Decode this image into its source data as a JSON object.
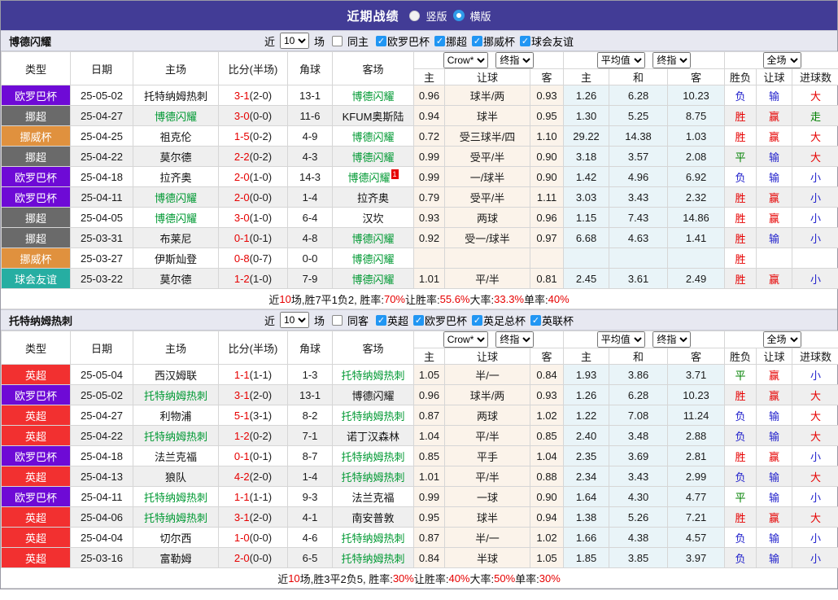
{
  "header": {
    "title": "近期战绩",
    "radio_vertical": "竖版",
    "radio_horizontal": "横版"
  },
  "colors": {
    "topbar_bg": "#423C96",
    "radio_selected_blue": "#2F9BE8",
    "checkbox_checked_blue": "#2196F3",
    "focus_team_green": "#009933",
    "score_red": "#E60000",
    "league_colors": {
      "欧罗巴杯": "#6E0AD6",
      "挪超": "#6A6A6A",
      "挪威杯": "#E0913E",
      "球会友谊": "#26AEA2",
      "英超": "#F23030"
    },
    "result_map": {
      "胜": "#E60000",
      "赢": "#E60000",
      "大": "#E60000",
      "平": "#008000",
      "走": "#008000",
      "负": "#2222CC",
      "输": "#2222CC",
      "小": "#2222CC"
    }
  },
  "table_header": {
    "col_type": "类型",
    "col_date": "日期",
    "col_home": "主场",
    "col_score": "比分(半场)",
    "col_corner": "角球",
    "col_away": "客场",
    "odds_select1": "Crow*",
    "odds_select2": "终指",
    "avg_select1": "平均值",
    "avg_select2": "终指",
    "result_select": "全场",
    "sub_home": "主",
    "sub_handicap": "让球",
    "sub_away": "客",
    "sub_avg_home": "主",
    "sub_avg_draw": "和",
    "sub_avg_away": "客",
    "sub_result": "胜负",
    "sub_result_handicap": "让球",
    "sub_goals": "进球数"
  },
  "sections": [
    {
      "team": "博德闪耀",
      "filter": {
        "near": "近",
        "count": "10",
        "games": "场",
        "same_label": "同主",
        "same_checked": false,
        "leagues": [
          "欧罗巴杯",
          "挪超",
          "挪威杯",
          "球会友谊"
        ]
      },
      "rows": [
        {
          "league": "欧罗巴杯",
          "date": "25-05-02",
          "home": "托特纳姆热刺",
          "home_focus": false,
          "score": "3-1",
          "half": "(2-0)",
          "corner": "13-1",
          "away": "博德闪耀",
          "away_focus": true,
          "away_sup": "",
          "h_odds": "0.96",
          "handicap": "球半/两",
          "a_odds": "0.93",
          "avg_h": "1.26",
          "avg_d": "6.28",
          "avg_a": "10.23",
          "result": "负",
          "h_result": "输",
          "goals": "大"
        },
        {
          "league": "挪超",
          "date": "25-04-27",
          "home": "博德闪耀",
          "home_focus": true,
          "score": "3-0",
          "half": "(0-0)",
          "corner": "11-6",
          "away": "KFUM奥斯陆",
          "away_focus": false,
          "away_sup": "",
          "h_odds": "0.94",
          "handicap": "球半",
          "a_odds": "0.95",
          "avg_h": "1.30",
          "avg_d": "5.25",
          "avg_a": "8.75",
          "result": "胜",
          "h_result": "赢",
          "goals": "走"
        },
        {
          "league": "挪威杯",
          "date": "25-04-25",
          "home": "祖克伦",
          "home_focus": false,
          "score": "1-5",
          "half": "(0-2)",
          "corner": "4-9",
          "away": "博德闪耀",
          "away_focus": true,
          "away_sup": "",
          "h_odds": "0.72",
          "handicap": "受三球半/四",
          "a_odds": "1.10",
          "avg_h": "29.22",
          "avg_d": "14.38",
          "avg_a": "1.03",
          "result": "胜",
          "h_result": "赢",
          "goals": "大"
        },
        {
          "league": "挪超",
          "date": "25-04-22",
          "home": "莫尔德",
          "home_focus": false,
          "score": "2-2",
          "half": "(0-2)",
          "corner": "4-3",
          "away": "博德闪耀",
          "away_focus": true,
          "away_sup": "",
          "h_odds": "0.99",
          "handicap": "受平/半",
          "a_odds": "0.90",
          "avg_h": "3.18",
          "avg_d": "3.57",
          "avg_a": "2.08",
          "result": "平",
          "h_result": "输",
          "goals": "大"
        },
        {
          "league": "欧罗巴杯",
          "date": "25-04-18",
          "home": "拉齐奥",
          "home_focus": false,
          "score": "2-0",
          "half": "(1-0)",
          "corner": "14-3",
          "away": "博德闪耀",
          "away_focus": true,
          "away_sup": "1",
          "h_odds": "0.99",
          "handicap": "一/球半",
          "a_odds": "0.90",
          "avg_h": "1.42",
          "avg_d": "4.96",
          "avg_a": "6.92",
          "result": "负",
          "h_result": "输",
          "goals": "小"
        },
        {
          "league": "欧罗巴杯",
          "date": "25-04-11",
          "home": "博德闪耀",
          "home_focus": true,
          "score": "2-0",
          "half": "(0-0)",
          "corner": "1-4",
          "away": "拉齐奥",
          "away_focus": false,
          "away_sup": "",
          "h_odds": "0.79",
          "handicap": "受平/半",
          "a_odds": "1.11",
          "avg_h": "3.03",
          "avg_d": "3.43",
          "avg_a": "2.32",
          "result": "胜",
          "h_result": "赢",
          "goals": "小"
        },
        {
          "league": "挪超",
          "date": "25-04-05",
          "home": "博德闪耀",
          "home_focus": true,
          "score": "3-0",
          "half": "(1-0)",
          "corner": "6-4",
          "away": "汉坎",
          "away_focus": false,
          "away_sup": "",
          "h_odds": "0.93",
          "handicap": "两球",
          "a_odds": "0.96",
          "avg_h": "1.15",
          "avg_d": "7.43",
          "avg_a": "14.86",
          "result": "胜",
          "h_result": "赢",
          "goals": "小"
        },
        {
          "league": "挪超",
          "date": "25-03-31",
          "home": "布莱尼",
          "home_focus": false,
          "score": "0-1",
          "half": "(0-1)",
          "corner": "4-8",
          "away": "博德闪耀",
          "away_focus": true,
          "away_sup": "",
          "h_odds": "0.92",
          "handicap": "受一/球半",
          "a_odds": "0.97",
          "avg_h": "6.68",
          "avg_d": "4.63",
          "avg_a": "1.41",
          "result": "胜",
          "h_result": "输",
          "goals": "小"
        },
        {
          "league": "挪威杯",
          "date": "25-03-27",
          "home": "伊斯灿登",
          "home_focus": false,
          "score": "0-8",
          "half": "(0-7)",
          "corner": "0-0",
          "away": "博德闪耀",
          "away_focus": true,
          "away_sup": "",
          "h_odds": "",
          "handicap": "",
          "a_odds": "",
          "avg_h": "",
          "avg_d": "",
          "avg_a": "",
          "result": "胜",
          "h_result": "",
          "goals": ""
        },
        {
          "league": "球会友谊",
          "date": "25-03-22",
          "home": "莫尔德",
          "home_focus": false,
          "score": "1-2",
          "half": "(1-0)",
          "corner": "7-9",
          "away": "博德闪耀",
          "away_focus": true,
          "away_sup": "",
          "h_odds": "1.01",
          "handicap": "平/半",
          "a_odds": "0.81",
          "avg_h": "2.45",
          "avg_d": "3.61",
          "avg_a": "2.49",
          "result": "胜",
          "h_result": "赢",
          "goals": "小"
        }
      ],
      "summary": [
        [
          "近",
          0
        ],
        [
          "10",
          1
        ],
        [
          "场,胜7平1负2, 胜率:",
          0
        ],
        [
          "70%",
          1
        ],
        [
          " 让胜率:",
          0
        ],
        [
          "55.6%",
          1
        ],
        [
          " 大率:",
          0
        ],
        [
          "33.3%",
          1
        ],
        [
          " 单率:",
          0
        ],
        [
          "40%",
          1
        ]
      ]
    },
    {
      "team": "托特纳姆热刺",
      "filter": {
        "near": "近",
        "count": "10",
        "games": "场",
        "same_label": "同客",
        "same_checked": false,
        "leagues": [
          "英超",
          "欧罗巴杯",
          "英足总杯",
          "英联杯"
        ]
      },
      "rows": [
        {
          "league": "英超",
          "date": "25-05-04",
          "home": "西汉姆联",
          "home_focus": false,
          "score": "1-1",
          "half": "(1-1)",
          "corner": "1-3",
          "away": "托特纳姆热刺",
          "away_focus": true,
          "away_sup": "",
          "h_odds": "1.05",
          "handicap": "半/一",
          "a_odds": "0.84",
          "avg_h": "1.93",
          "avg_d": "3.86",
          "avg_a": "3.71",
          "result": "平",
          "h_result": "赢",
          "goals": "小"
        },
        {
          "league": "欧罗巴杯",
          "date": "25-05-02",
          "home": "托特纳姆热刺",
          "home_focus": true,
          "score": "3-1",
          "half": "(2-0)",
          "corner": "13-1",
          "away": "博德闪耀",
          "away_focus": false,
          "away_sup": "",
          "h_odds": "0.96",
          "handicap": "球半/两",
          "a_odds": "0.93",
          "avg_h": "1.26",
          "avg_d": "6.28",
          "avg_a": "10.23",
          "result": "胜",
          "h_result": "赢",
          "goals": "大"
        },
        {
          "league": "英超",
          "date": "25-04-27",
          "home": "利物浦",
          "home_focus": false,
          "score": "5-1",
          "half": "(3-1)",
          "corner": "8-2",
          "away": "托特纳姆热刺",
          "away_focus": true,
          "away_sup": "",
          "h_odds": "0.87",
          "handicap": "两球",
          "a_odds": "1.02",
          "avg_h": "1.22",
          "avg_d": "7.08",
          "avg_a": "11.24",
          "result": "负",
          "h_result": "输",
          "goals": "大"
        },
        {
          "league": "英超",
          "date": "25-04-22",
          "home": "托特纳姆热刺",
          "home_focus": true,
          "score": "1-2",
          "half": "(0-2)",
          "corner": "7-1",
          "away": "诺丁汉森林",
          "away_focus": false,
          "away_sup": "",
          "h_odds": "1.04",
          "handicap": "平/半",
          "a_odds": "0.85",
          "avg_h": "2.40",
          "avg_d": "3.48",
          "avg_a": "2.88",
          "result": "负",
          "h_result": "输",
          "goals": "大"
        },
        {
          "league": "欧罗巴杯",
          "date": "25-04-18",
          "home": "法兰克福",
          "home_focus": false,
          "score": "0-1",
          "half": "(0-1)",
          "corner": "8-7",
          "away": "托特纳姆热刺",
          "away_focus": true,
          "away_sup": "",
          "h_odds": "0.85",
          "handicap": "平手",
          "a_odds": "1.04",
          "avg_h": "2.35",
          "avg_d": "3.69",
          "avg_a": "2.81",
          "result": "胜",
          "h_result": "赢",
          "goals": "小"
        },
        {
          "league": "英超",
          "date": "25-04-13",
          "home": "狼队",
          "home_focus": false,
          "score": "4-2",
          "half": "(2-0)",
          "corner": "1-4",
          "away": "托特纳姆热刺",
          "away_focus": true,
          "away_sup": "",
          "h_odds": "1.01",
          "handicap": "平/半",
          "a_odds": "0.88",
          "avg_h": "2.34",
          "avg_d": "3.43",
          "avg_a": "2.99",
          "result": "负",
          "h_result": "输",
          "goals": "大"
        },
        {
          "league": "欧罗巴杯",
          "date": "25-04-11",
          "home": "托特纳姆热刺",
          "home_focus": true,
          "score": "1-1",
          "half": "(1-1)",
          "corner": "9-3",
          "away": "法兰克福",
          "away_focus": false,
          "away_sup": "",
          "h_odds": "0.99",
          "handicap": "一球",
          "a_odds": "0.90",
          "avg_h": "1.64",
          "avg_d": "4.30",
          "avg_a": "4.77",
          "result": "平",
          "h_result": "输",
          "goals": "小"
        },
        {
          "league": "英超",
          "date": "25-04-06",
          "home": "托特纳姆热刺",
          "home_focus": true,
          "score": "3-1",
          "half": "(2-0)",
          "corner": "4-1",
          "away": "南安普敦",
          "away_focus": false,
          "away_sup": "",
          "h_odds": "0.95",
          "handicap": "球半",
          "a_odds": "0.94",
          "avg_h": "1.38",
          "avg_d": "5.26",
          "avg_a": "7.21",
          "result": "胜",
          "h_result": "赢",
          "goals": "大"
        },
        {
          "league": "英超",
          "date": "25-04-04",
          "home": "切尔西",
          "home_focus": false,
          "score": "1-0",
          "half": "(0-0)",
          "corner": "4-6",
          "away": "托特纳姆热刺",
          "away_focus": true,
          "away_sup": "",
          "h_odds": "0.87",
          "handicap": "半/一",
          "a_odds": "1.02",
          "avg_h": "1.66",
          "avg_d": "4.38",
          "avg_a": "4.57",
          "result": "负",
          "h_result": "输",
          "goals": "小"
        },
        {
          "league": "英超",
          "date": "25-03-16",
          "home": "富勒姆",
          "home_focus": false,
          "score": "2-0",
          "half": "(0-0)",
          "corner": "6-5",
          "away": "托特纳姆热刺",
          "away_focus": true,
          "away_sup": "",
          "h_odds": "0.84",
          "handicap": "半球",
          "a_odds": "1.05",
          "avg_h": "1.85",
          "avg_d": "3.85",
          "avg_a": "3.97",
          "result": "负",
          "h_result": "输",
          "goals": "小"
        }
      ],
      "summary": [
        [
          "近",
          0
        ],
        [
          "10",
          1
        ],
        [
          "场,胜3平2负5, 胜率:",
          0
        ],
        [
          "30%",
          1
        ],
        [
          " 让胜率:",
          0
        ],
        [
          "40%",
          1
        ],
        [
          " 大率:",
          0
        ],
        [
          "50%",
          1
        ],
        [
          " 单率:",
          0
        ],
        [
          "30%",
          1
        ]
      ]
    }
  ]
}
